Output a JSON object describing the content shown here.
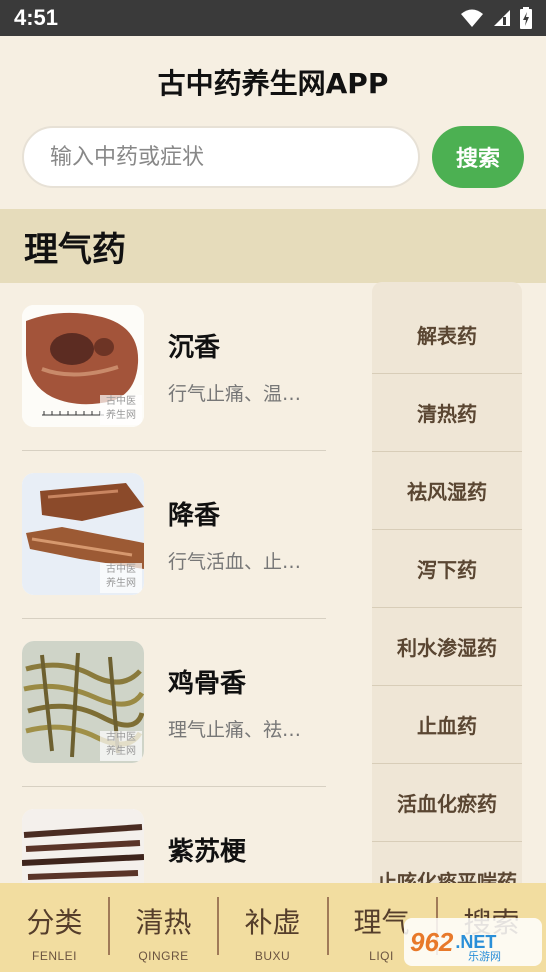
{
  "status_bar": {
    "time": "4:51"
  },
  "header": {
    "title": "古中药养生网APP"
  },
  "search": {
    "placeholder": "输入中药或症状",
    "button_label": "搜索"
  },
  "section": {
    "title": "理气药"
  },
  "herbs": [
    {
      "name": "沉香",
      "desc": "行气止痛、温…",
      "watermark": "古中医 养生网"
    },
    {
      "name": "降香",
      "desc": "行气活血、止…",
      "watermark": "古中医 养生网"
    },
    {
      "name": "鸡骨香",
      "desc": "理气止痛、祛…",
      "watermark": "古中医 养生网"
    },
    {
      "name": "紫苏梗",
      "desc": "",
      "watermark": ""
    }
  ],
  "side_nav": [
    {
      "label": "解表药"
    },
    {
      "label": "清热药"
    },
    {
      "label": "祛风湿药"
    },
    {
      "label": "泻下药"
    },
    {
      "label": "利水渗湿药"
    },
    {
      "label": "止血药"
    },
    {
      "label": "活血化瘀药"
    },
    {
      "label": "止咳化痰平喘药"
    }
  ],
  "tabs": [
    {
      "zh": "分类",
      "py": "FENLEI"
    },
    {
      "zh": "清热",
      "py": "QINGRE"
    },
    {
      "zh": "补虚",
      "py": "BUXU"
    },
    {
      "zh": "理气",
      "py": "LIQI"
    },
    {
      "zh": "搜索",
      "py": ""
    }
  ],
  "watermark_badge": {
    "main": "962",
    "net": ".NET",
    "sub": "乐游网"
  },
  "colors": {
    "accent_green": "#4cb052",
    "section_bar": "#e6dcbb",
    "bottom_bar": "#f2dda0",
    "background": "#f6efe2"
  }
}
